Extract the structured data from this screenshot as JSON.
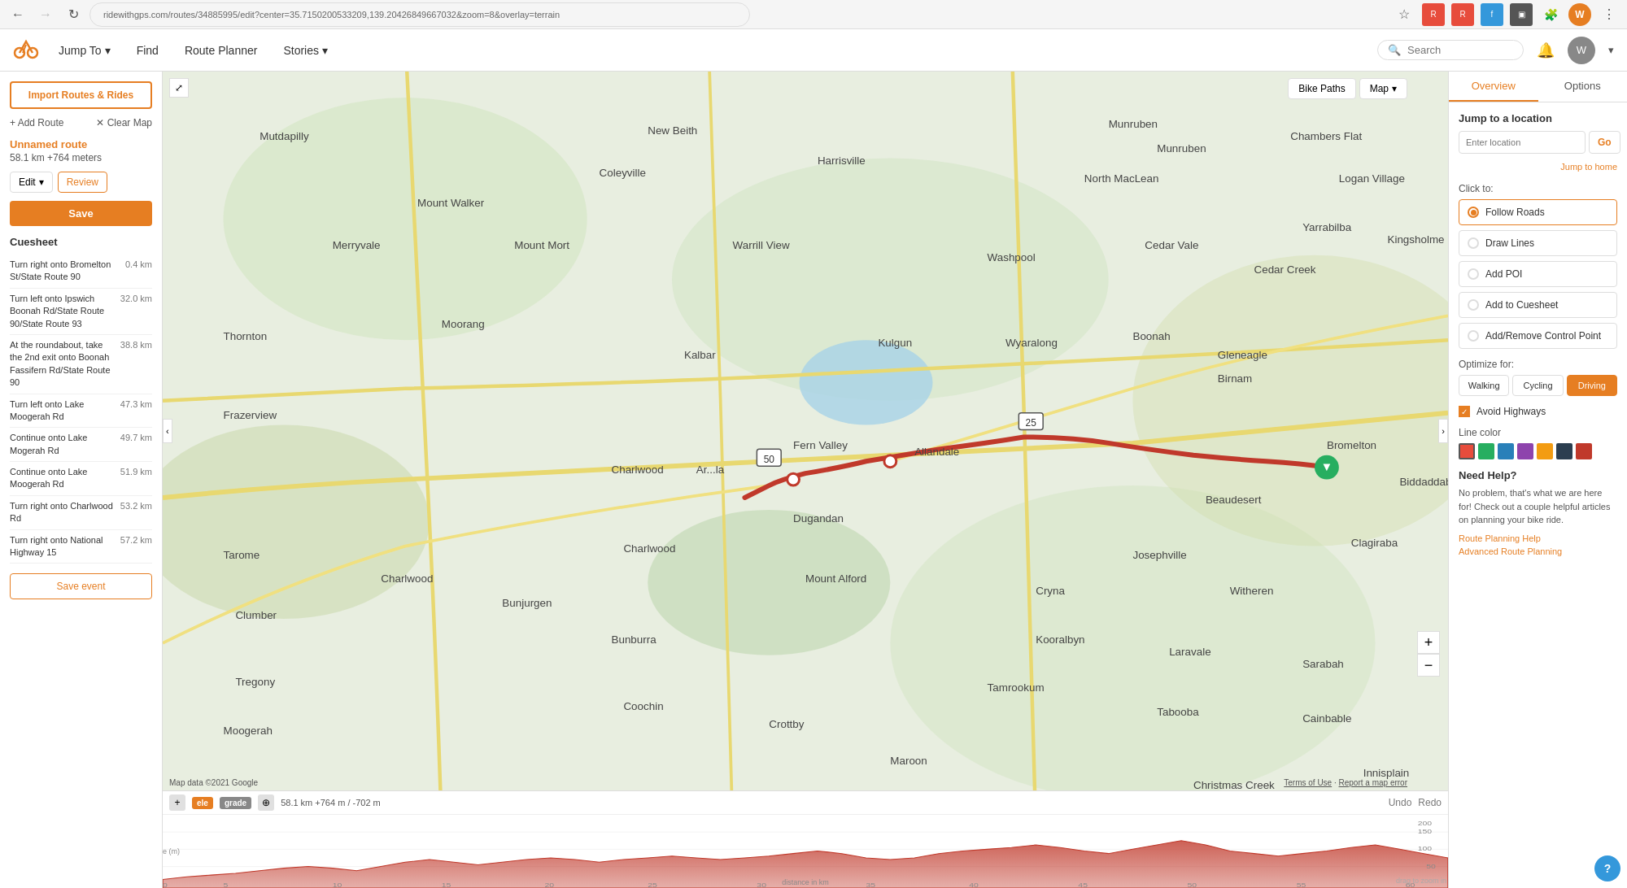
{
  "browser": {
    "url": "ridewithgps.com/routes/34885995/edit?center=35.71502005332​09,139.20426849667032&zoom=8&overlay=terrain",
    "back_title": "Back",
    "forward_title": "Forward",
    "refresh_title": "Refresh"
  },
  "app_header": {
    "logo_title": "RideWithGPS",
    "nav_items": [
      {
        "label": "Jump To",
        "has_arrow": true
      },
      {
        "label": "Find"
      },
      {
        "label": "Route Planner"
      },
      {
        "label": "Stories",
        "has_arrow": true
      }
    ],
    "search_placeholder": "Search",
    "bell_title": "Notifications"
  },
  "left_sidebar": {
    "import_btn": "Import Routes & Rides",
    "add_route": "+ Add Route",
    "clear_map": "✕ Clear Map",
    "route_title": "Unnamed route",
    "route_subtitle": "58.1 km +764 meters",
    "edit_label": "Edit",
    "review_label": "Review",
    "save_label": "Save",
    "cuesheet_title": "Cuesheet",
    "cue_items": [
      {
        "text": "Turn right onto Bromelton St/State Route 90",
        "dist": "0.4 km"
      },
      {
        "text": "Turn left onto Ipswich Boonah Rd/State Route 90/State Route 93",
        "dist": "32.0 km"
      },
      {
        "text": "At the roundabout, take the 2nd exit onto Boonah Fassifern Rd/State Route 90",
        "dist": "38.8 km"
      },
      {
        "text": "Turn left onto Lake Moogerah Rd",
        "dist": "47.3 km"
      },
      {
        "text": "Continue onto Lake Mogerah Rd",
        "dist": "49.7 km"
      },
      {
        "text": "Continue onto Lake Moogerah Rd",
        "dist": "51.9 km"
      },
      {
        "text": "Turn right onto Charlwood Rd",
        "dist": "53.2 km"
      },
      {
        "text": "Turn right onto National Highway 15",
        "dist": "57.2 km"
      }
    ],
    "save_event_label": "Save event"
  },
  "map": {
    "toolbar": {
      "bike_paths": "Bike Paths",
      "map_label": "Map",
      "map_arrow": "▾"
    },
    "expand_icon": "⤢",
    "collapse_left": "‹",
    "collapse_right": "›",
    "zoom_in": "+",
    "zoom_out": "−",
    "copyright": "© Google",
    "map_data": "Map data ©2021 Google",
    "terms": "Terms of Use",
    "report": "Report a map error"
  },
  "elevation": {
    "plus_icon": "+",
    "ele_label": "ele",
    "grade_label": "grade",
    "zoom_icon": "⊕",
    "stats": "58.1 km +764 m / -702 m",
    "undo": "Undo",
    "redo": "Redo"
  },
  "right_sidebar": {
    "tabs": [
      {
        "label": "Overview",
        "active": true
      },
      {
        "label": "Options"
      }
    ],
    "jump_location": {
      "title": "Jump to a location",
      "placeholder": "Enter location",
      "go_label": "Go",
      "jump_home": "Jump to home"
    },
    "click_to": {
      "label": "Click to:",
      "options": [
        {
          "label": "Follow Roads",
          "selected": true
        },
        {
          "label": "Draw Lines",
          "selected": false
        },
        {
          "label": "Add POI",
          "selected": false
        },
        {
          "label": "Add to Cuesheet",
          "selected": false
        },
        {
          "label": "Add/Remove Control Point",
          "selected": false
        }
      ]
    },
    "optimize": {
      "label": "Optimize for:",
      "options": [
        {
          "label": "Walking",
          "active": false
        },
        {
          "label": "Cycling",
          "active": false
        },
        {
          "label": "Driving",
          "active": true
        }
      ]
    },
    "avoid_highways": {
      "checked": true,
      "label": "Avoid Highways"
    },
    "line_color": {
      "label": "Line color",
      "swatches": [
        {
          "color": "#e74c3c",
          "selected": true
        },
        {
          "color": "#27ae60"
        },
        {
          "color": "#2980b9"
        },
        {
          "color": "#8e44ad"
        },
        {
          "color": "#f39c12"
        },
        {
          "color": "#2c3e50"
        },
        {
          "color": "#c0392b"
        }
      ]
    },
    "need_help": {
      "title": "Need Help?",
      "text": "No problem, that's what we are here for! Check out a couple helpful articles on planning your bike ride.",
      "links": [
        "Route Planning Help",
        "Advanced Route Planning"
      ]
    },
    "help_icon": "?"
  }
}
